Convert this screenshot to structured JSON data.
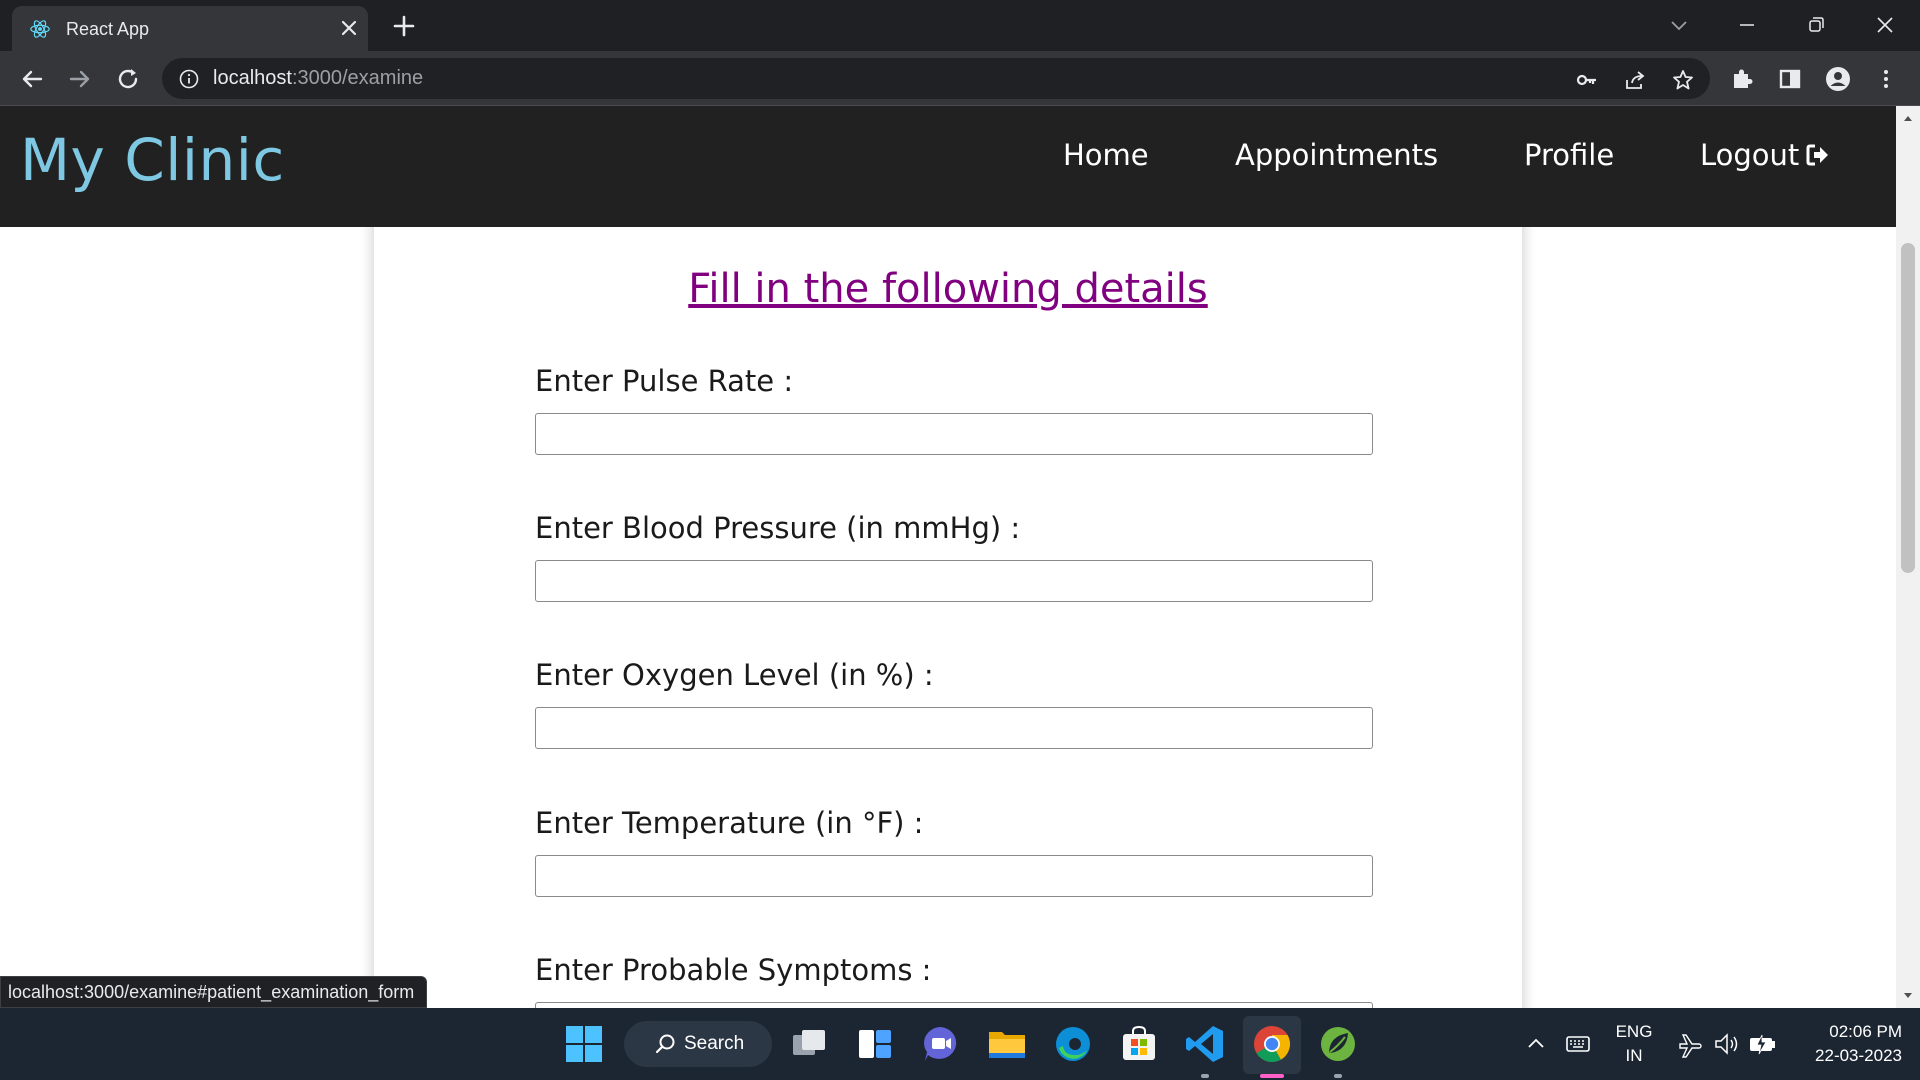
{
  "browser": {
    "tab_title": "React App",
    "address_host": "localhost",
    "address_path": ":3000/examine",
    "status_url": "localhost:3000/examine#patient_examination_form"
  },
  "app": {
    "brand": "My Clinic",
    "nav": {
      "home": "Home",
      "appointments": "Appointments",
      "profile": "Profile",
      "logout": "Logout"
    }
  },
  "form": {
    "title": "Fill in the following details",
    "fields": [
      {
        "label": "Enter Pulse Rate :",
        "value": ""
      },
      {
        "label": "Enter Blood Pressure (in mmHg) :",
        "value": ""
      },
      {
        "label": "Enter Oxygen Level (in %) :",
        "value": ""
      },
      {
        "label": "Enter Temperature (in °F) :",
        "value": ""
      },
      {
        "label": "Enter Probable Symptoms :",
        "value": ""
      }
    ]
  },
  "taskbar": {
    "search_label": "Search",
    "language_top": "ENG",
    "language_bottom": "IN",
    "time": "02:06 PM",
    "date": "22-03-2023"
  },
  "colors": {
    "brand": "#7ec8e3",
    "header_bg": "#212121",
    "form_title": "#800080",
    "taskbar_bg": "#1c2633"
  }
}
